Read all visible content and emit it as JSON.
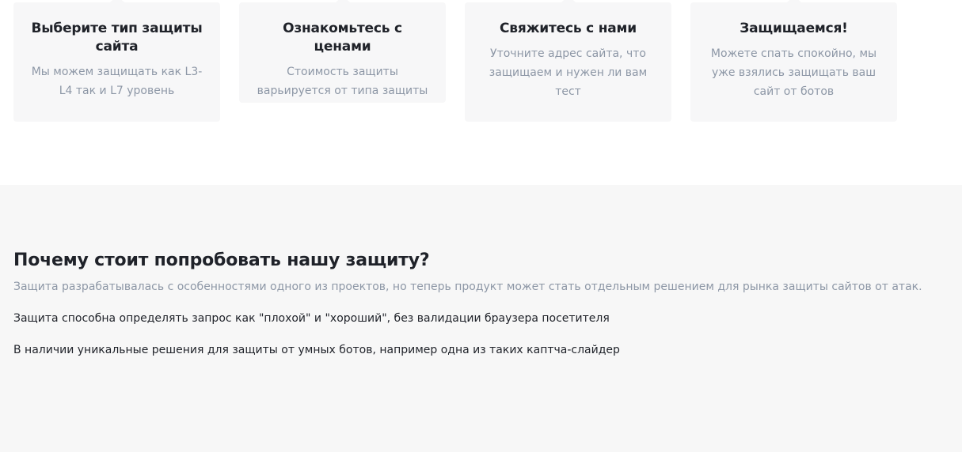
{
  "steps": [
    {
      "title": "Выберите тип защиты сайта",
      "description": "Мы можем защищать как L3-L4 так и L7 уровень"
    },
    {
      "title": "Ознакомьтесь с ценами",
      "description": "Стоимость защиты варьируется от типа защиты"
    },
    {
      "title": "Свяжитесь с нами",
      "description": "Уточните адрес сайта, что защищаем и нужен ли вам тест"
    },
    {
      "title": "Защищаемся!",
      "description": "Можете спать спокойно, мы уже взялись защищать ваш сайт от ботов"
    }
  ],
  "why": {
    "heading": "Почему стоит попробовать нашу защиту?",
    "lead": "Защита разрабатывалась с особенностями одного из проектов, но теперь продукт может стать отдельным решением для рынка защиты сайтов от атак.",
    "points": [
      "Защита способна определять запрос как \"плохой\" и \"хороший\", без валидации браузера посетителя",
      "В наличии уникальные решения для защиты от умных ботов, например одна из таких каптча-слайдер"
    ]
  },
  "colors": {
    "card_background": "#f7f7f8",
    "section_background": "#f7f7f7",
    "heading_text": "#1f2229",
    "muted_text": "#8d97a6"
  }
}
